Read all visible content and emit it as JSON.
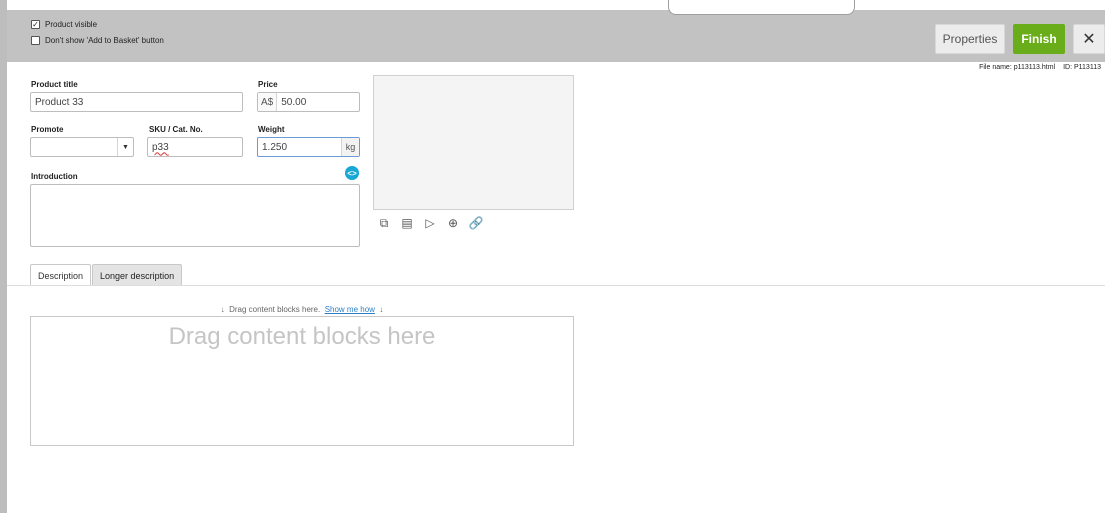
{
  "topbar": {
    "product_visible_label": "Product visible",
    "product_visible_checked": true,
    "hide_basket_label": "Don't show 'Add to Basket' button",
    "hide_basket_checked": false,
    "properties_label": "Properties",
    "finish_label": "Finish",
    "close_glyph": "✕",
    "colors": {
      "bar": "#c2c2c2",
      "finish": "#6aad1a"
    }
  },
  "file": {
    "name_text": "File name: p113113.html",
    "id_text": "ID: P113113"
  },
  "form": {
    "title_label": "Product title",
    "title_value": "Product 33",
    "price_label": "Price",
    "price_prefix": "A$",
    "price_value": "50.00",
    "promote_label": "Promote",
    "promote_value": "",
    "sku_label": "SKU / Cat. No.",
    "sku_value": "p33",
    "weight_label": "Weight",
    "weight_value": "1.250",
    "weight_unit": "kg",
    "intro_label": "Introduction",
    "code_glyph": "<>"
  },
  "image_tools": {
    "icons": [
      "image-icon",
      "gallery-icon",
      "play-icon",
      "zoom-icon",
      "link-icon"
    ],
    "glyphs": [
      "⧉",
      "▤",
      "▷",
      "⊕",
      "🔗"
    ]
  },
  "tabs": {
    "description": "Description",
    "longer": "Longer description"
  },
  "content": {
    "hint_text": "Drag content blocks here.",
    "hint_link": "Show me how",
    "hint_arrow": "↓",
    "placeholder": "Drag content blocks here"
  }
}
